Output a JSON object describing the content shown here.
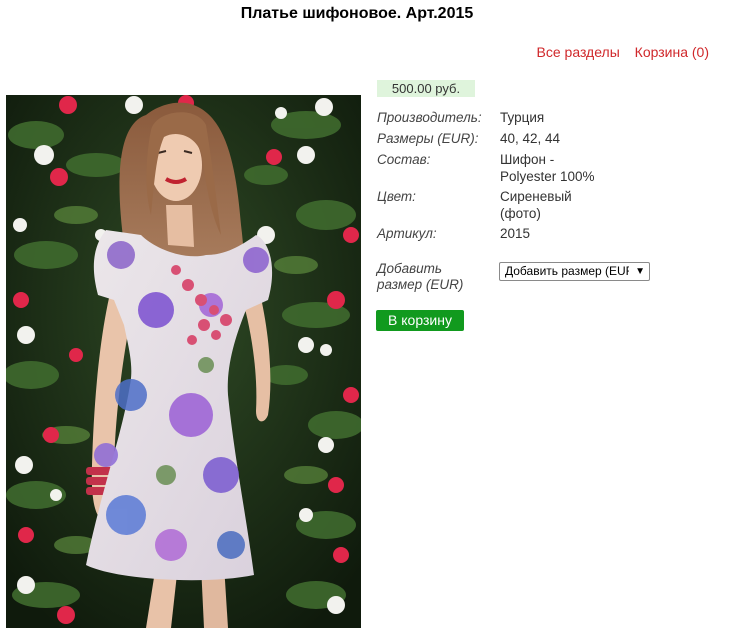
{
  "page": {
    "title": "Платье шифоновое. Арт.2015"
  },
  "nav": {
    "all_sections": "Все разделы",
    "cart": "Корзина (0)"
  },
  "product": {
    "price": "500.00 руб.",
    "props": {
      "maker_label": "Производитель:",
      "maker_value": "Турция",
      "sizes_label": "Размеры (EUR):",
      "sizes_value": "40, 42, 44",
      "composition_label": "Состав:",
      "composition_value_1": "Шифон -",
      "composition_value_2": "Polyester 100%",
      "color_label": "Цвет:",
      "color_value_1": "Сиреневый",
      "color_value_2": "(фото)",
      "article_label": "Артикул:",
      "article_value": "2015"
    },
    "add_size_label_1": "Добавить",
    "add_size_label_2": "размер (EUR)",
    "size_select_value": "Добавить размер (EUR)",
    "add_to_cart": "В корзину"
  },
  "colors": {
    "link": "#d0282b",
    "button": "#119a1e",
    "price_bg": "#dff4dc"
  }
}
